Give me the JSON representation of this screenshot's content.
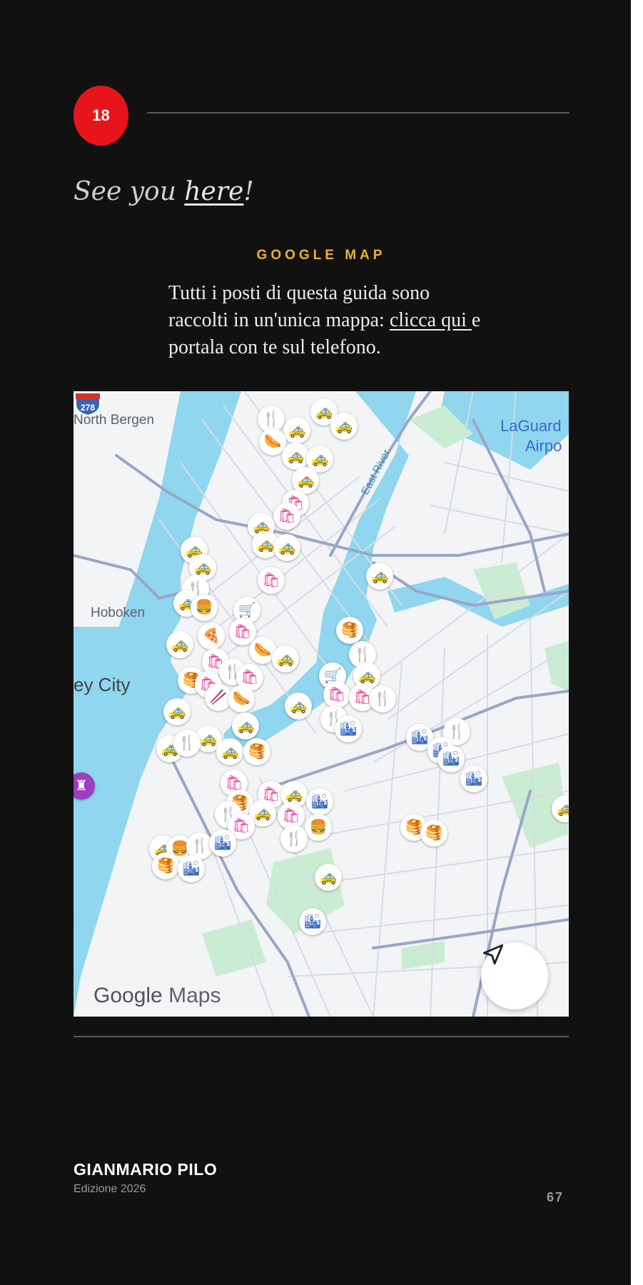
{
  "chapter": {
    "number": "18"
  },
  "heading": {
    "prefix": "See you ",
    "link": "here",
    "suffix": "!"
  },
  "section": {
    "kicker": "GOOGLE MAP",
    "text_before": "Tutti i posti di questa guida sono raccolti in un'unica mappa: ",
    "link": "clicca qui ",
    "text_after": "e portala con te sul telefono."
  },
  "map": {
    "labels": {
      "north_bergen": "North Bergen",
      "hoboken": "Hoboken",
      "jersey_city": "ey City",
      "east_river": "East River",
      "laguardia_1": "LaGuard",
      "laguardia_2": "Airpo"
    },
    "highway_shield": "278",
    "logo_google": "Google",
    "logo_maps": "Maps",
    "nav_button_icon": "navigation-arrow-icon",
    "colors": {
      "water": "#8fd6ee",
      "park": "#c9ecd2",
      "road": "#9aa6c8",
      "land": "#f3f4f6"
    }
  },
  "footer": {
    "author": "GIANMARIO PILO",
    "edition": "Edizione 2026",
    "page_number": "67"
  },
  "colors": {
    "background": "#111111",
    "accent_red": "#e8141b",
    "kicker_gold": "#e8b527"
  }
}
